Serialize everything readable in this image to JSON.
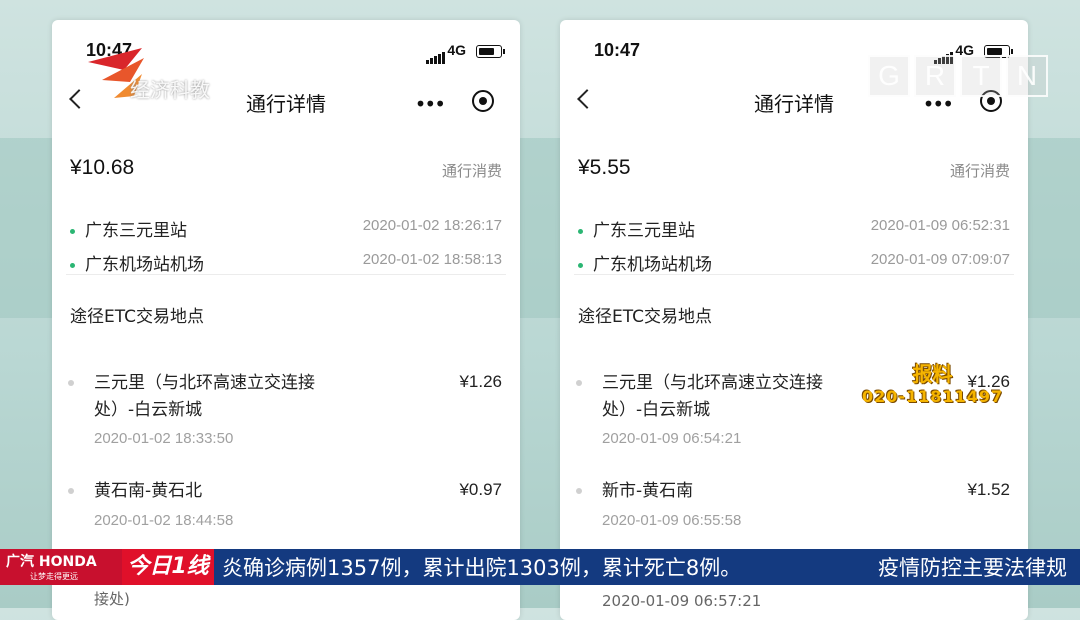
{
  "left": {
    "time": "10:47",
    "network": "4G",
    "title": "通行详情",
    "amount": "¥10.68",
    "type_label": "通行消费",
    "entry_station": "广东三元里站",
    "entry_time": "2020-01-02 18:26:17",
    "exit_station": "广东机场站机场",
    "exit_time": "2020-01-02 18:58:13",
    "section_title": "途径ETC交易地点",
    "transactions": [
      {
        "name": "三元里（与北环高速立交连接处）-白云新城",
        "price": "¥1.26",
        "time": "2020-01-02 18:33:50"
      },
      {
        "name": "黄石南-黄石北",
        "price": "¥0.97",
        "time": "2020-01-02 18:44:58"
      }
    ],
    "peek_text": "接处)"
  },
  "right": {
    "time": "10:47",
    "network": "4G",
    "title": "通行详情",
    "amount": "¥5.55",
    "type_label": "通行消费",
    "entry_station": "广东三元里站",
    "entry_time": "2020-01-09 06:52:31",
    "exit_station": "广东机场站机场",
    "exit_time": "2020-01-09 07:09:07",
    "section_title": "途径ETC交易地点",
    "transactions": [
      {
        "name": "三元里（与北环高速立交连接处）-白云新城",
        "price": "¥1.26",
        "time": "2020-01-09 06:54:21"
      },
      {
        "name": "新市-黄石南",
        "price": "¥1.52",
        "time": "2020-01-09 06:55:58"
      }
    ],
    "peek_text": "2020-01-09 06:57:21"
  },
  "overlay": {
    "logo_text": "经济科教",
    "watermark_letters": [
      "G",
      "R",
      "T",
      "N"
    ],
    "tipoff_title": "报料",
    "tipoff_phone": "020-11811497",
    "ticker_brand": "广汽 HONDA",
    "ticker_slogan": "让梦走得更远",
    "ticker_channel": "今日1线",
    "ticker_news": "炎确诊病例1357例，累计出院1303例，累计死亡8例。",
    "ticker_news2": "疫情防控主要法律规"
  },
  "colors": {
    "brand_red": "#c8102e",
    "ticker_blue": "#143a80",
    "station_dot_green": "#2bb673",
    "tipoff_yellow": "#f5b400"
  }
}
